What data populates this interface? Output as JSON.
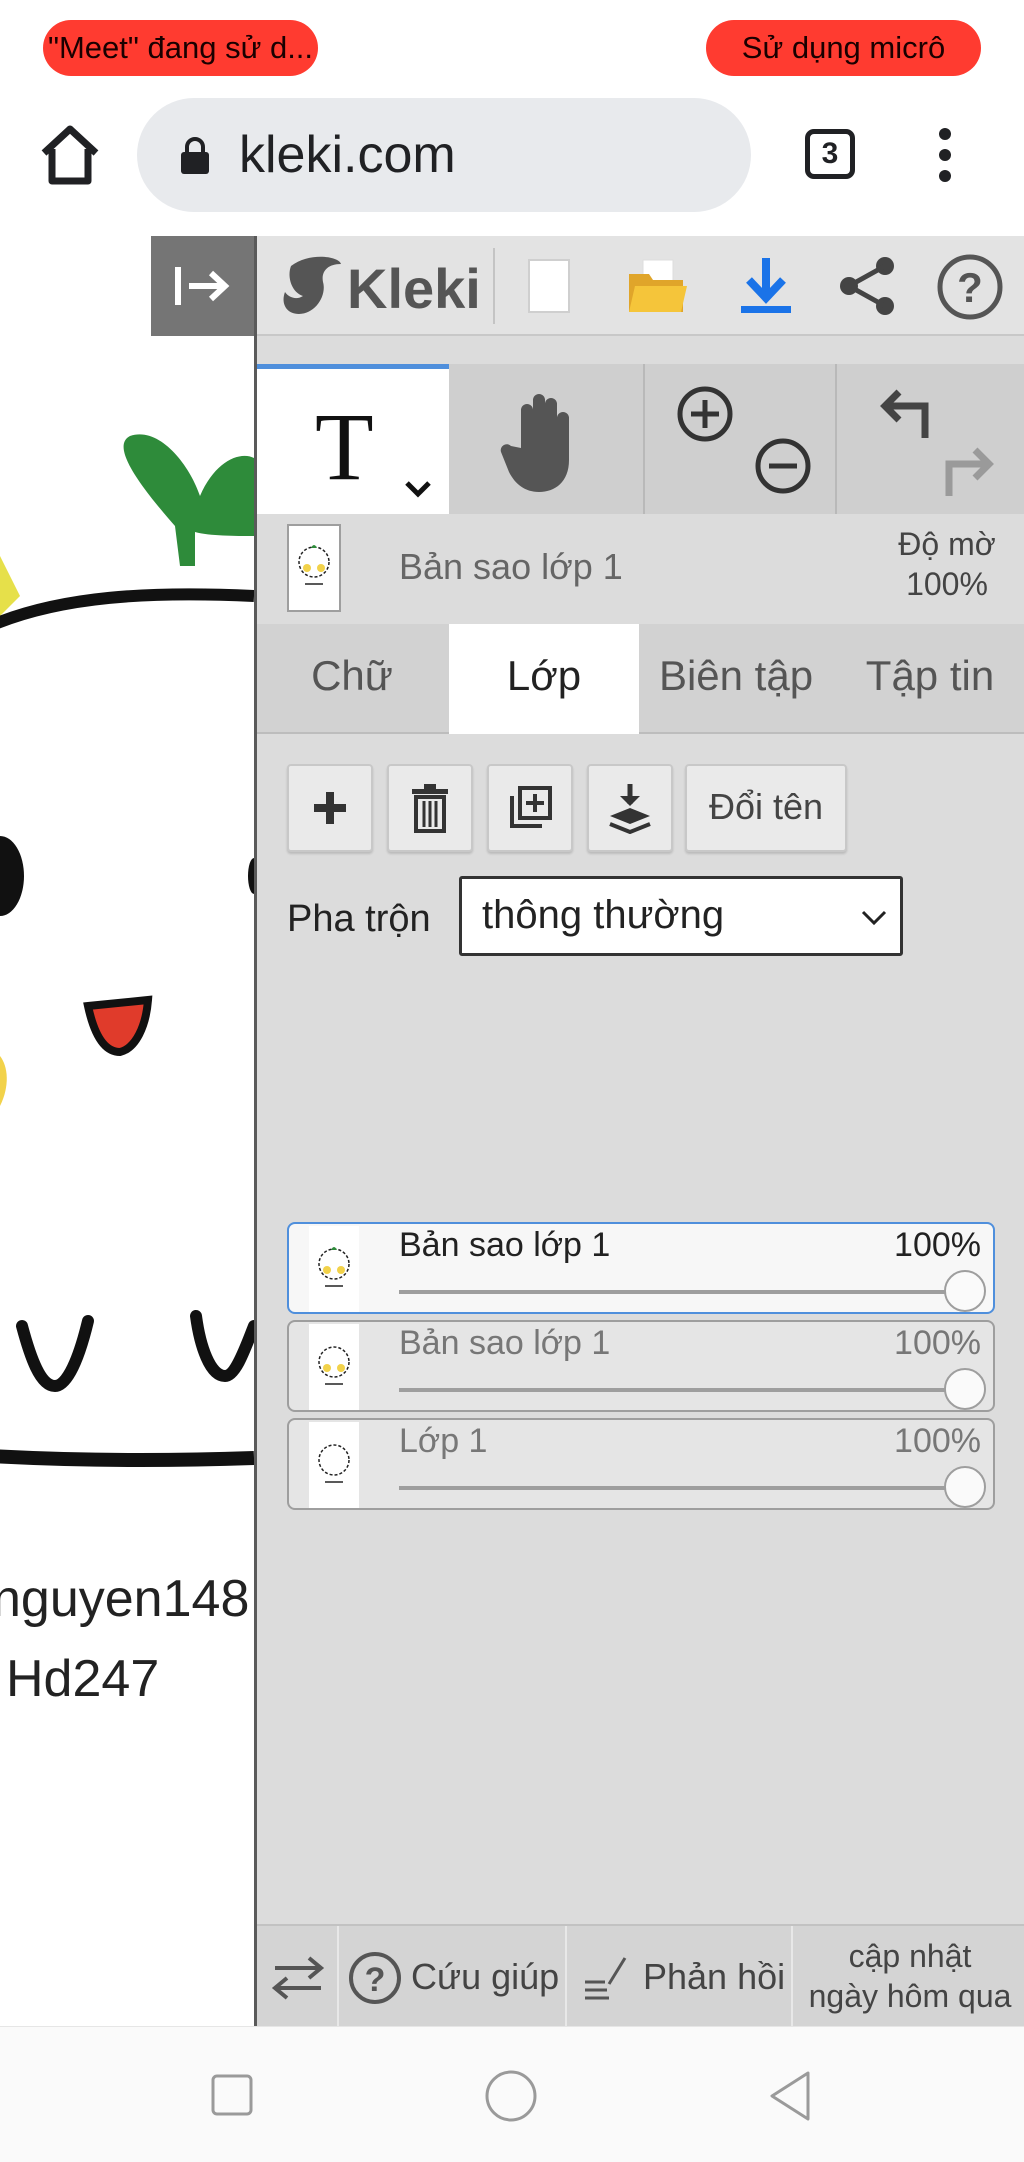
{
  "status_bar": {
    "left_pill": "\"Meet\" đang sử d...",
    "right_pill": "Sử dụng micrô",
    "pill_color": "#ff3b30"
  },
  "browser": {
    "url": "kleki.com",
    "tab_count": "3",
    "icons": [
      "home-icon",
      "lock-icon",
      "tabs-icon",
      "more-vert-icon"
    ]
  },
  "app": {
    "logo_text": "Kleki",
    "accent_color": "#4f8fdc",
    "topbar_icons": [
      "collapse-panel-icon",
      "new-image-icon",
      "open-folder-icon",
      "download-icon",
      "share-icon",
      "help-icon"
    ]
  },
  "tools": {
    "active": "T",
    "icons": [
      "text-tool-icon",
      "chevron-down-icon",
      "hand-tool-icon",
      "zoom-in-icon",
      "zoom-out-icon",
      "undo-icon",
      "redo-icon"
    ]
  },
  "layer_info": {
    "name": "Bản sao lớp 1",
    "opacity_label": "Độ mờ",
    "opacity_value": "100%"
  },
  "tabs": [
    "Chữ",
    "Lớp",
    "Biên tập",
    "Tập tin"
  ],
  "active_tab": "Lớp",
  "layer_actions": {
    "rename_label": "Đổi tên",
    "icons": [
      "add-layer-icon",
      "delete-layer-icon",
      "duplicate-layer-icon",
      "merge-down-icon"
    ]
  },
  "blend": {
    "label": "Pha trộn",
    "value": "thông thường"
  },
  "layers": [
    {
      "name": "Bản sao lớp 1",
      "opacity": "100%",
      "selected": true
    },
    {
      "name": "Bản sao lớp 1",
      "opacity": "100%",
      "selected": false
    },
    {
      "name": "Lớp 1",
      "opacity": "100%",
      "selected": false
    }
  ],
  "footer": {
    "help_label": "Cứu giúp",
    "feedback_label": "Phản hồi",
    "update_line1": "cập nhật",
    "update_line2": "ngày hôm qua"
  },
  "canvas_text": {
    "line1": "nguyen148",
    "line2": "Hd247"
  }
}
